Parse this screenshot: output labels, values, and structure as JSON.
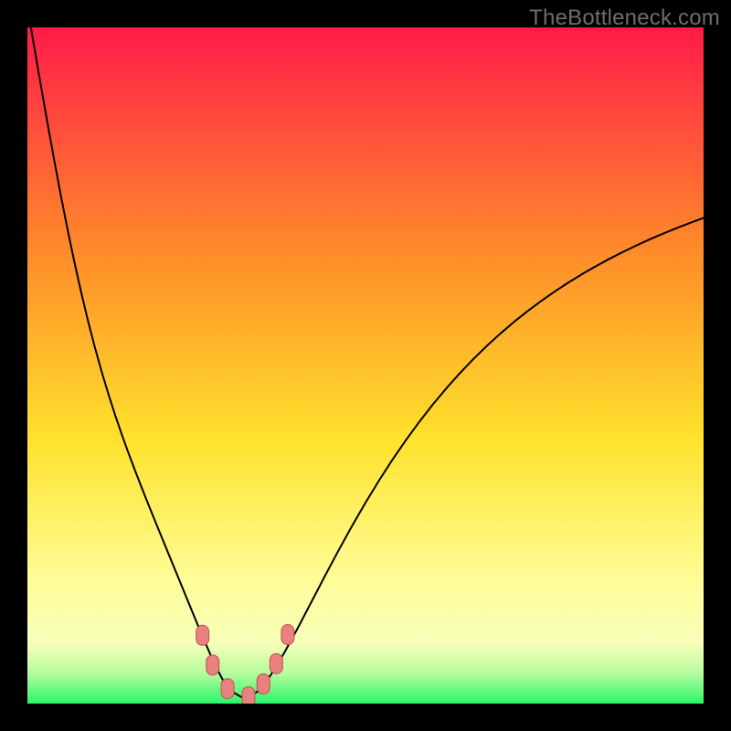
{
  "watermark": "TheBottleneck.com",
  "colors": {
    "top": "#ff1b49",
    "orange": "#ff8b2a",
    "yellow": "#ffe22c",
    "pale_yellow": "#fffd99",
    "green": "#29f669",
    "curve": "#000000",
    "marker_fill": "#e98181",
    "marker_stroke": "#c24e4e",
    "background": "#000000"
  },
  "chart_data": {
    "type": "line",
    "title": "",
    "xlabel": "",
    "ylabel": "",
    "xlim": [
      0,
      100
    ],
    "ylim": [
      0,
      100
    ],
    "curve": {
      "x": [
        0,
        1,
        2,
        3,
        4,
        5,
        6,
        7,
        8,
        9,
        10,
        11,
        12,
        13,
        14,
        15,
        16,
        17,
        18,
        19,
        20,
        21,
        22,
        23,
        24,
        25,
        26,
        27,
        28,
        29,
        30,
        32,
        34,
        36,
        38,
        40,
        42,
        44,
        46,
        48,
        50,
        52,
        54,
        56,
        58,
        60,
        62,
        64,
        66,
        68,
        70,
        72,
        74,
        76,
        78,
        80,
        82,
        84,
        86,
        88,
        90,
        92,
        94,
        96,
        98,
        100
      ],
      "y": [
        103.0,
        97.147,
        91.353,
        85.674,
        80.161,
        74.863,
        69.819,
        65.061,
        60.605,
        56.455,
        52.601,
        49.024,
        45.7,
        42.595,
        39.674,
        36.904,
        34.251,
        31.685,
        29.179,
        26.712,
        24.266,
        21.829,
        19.393,
        16.955,
        14.519,
        12.097,
        9.709,
        7.394,
        5.219,
        3.311,
        1.919,
        0.762,
        1.746,
        4.244,
        7.529,
        11.203,
        15.033,
        18.873,
        22.63,
        26.252,
        29.71,
        32.99,
        36.086,
        38.998,
        41.729,
        44.287,
        46.679,
        48.914,
        51.001,
        52.951,
        54.772,
        56.475,
        58.067,
        59.558,
        60.954,
        62.264,
        63.493,
        64.648,
        65.735,
        66.759,
        67.725,
        68.638,
        69.5,
        70.317,
        71.091,
        71.827
      ]
    },
    "markers": [
      {
        "x": 25.9,
        "y": 10.1
      },
      {
        "x": 27.4,
        "y": 5.7
      },
      {
        "x": 29.6,
        "y": 2.2
      },
      {
        "x": 32.7,
        "y": 1.0
      },
      {
        "x": 34.9,
        "y": 2.9
      },
      {
        "x": 36.8,
        "y": 5.9
      },
      {
        "x": 38.5,
        "y": 10.2
      }
    ],
    "gradient_stops": [
      {
        "offset": 0.0,
        "color": "#ff1b49"
      },
      {
        "offset": 0.33,
        "color": "#ff8b2a"
      },
      {
        "offset": 0.61,
        "color": "#ffe22c"
      },
      {
        "offset": 0.82,
        "color": "#fffd99"
      },
      {
        "offset": 0.91,
        "color": "#f7ffb9"
      },
      {
        "offset": 0.955,
        "color": "#b7fc9f"
      },
      {
        "offset": 1.0,
        "color": "#29f669"
      }
    ]
  }
}
